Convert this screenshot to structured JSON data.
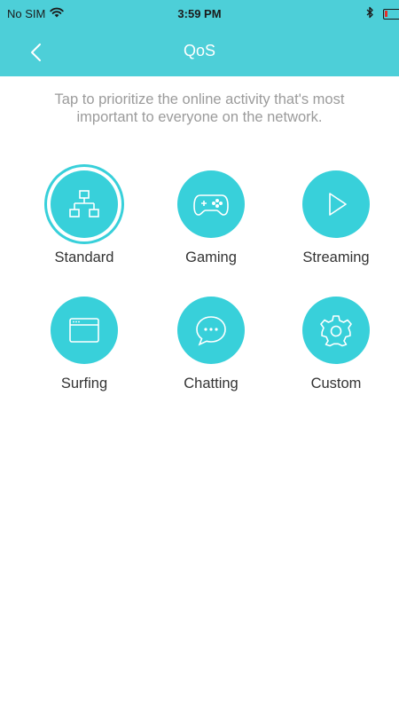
{
  "status_bar": {
    "carrier": "No SIM",
    "time": "3:59 PM",
    "wifi_icon": "wifi-icon",
    "bluetooth_icon": "bluetooth-icon",
    "battery_icon": "battery-low-icon"
  },
  "nav": {
    "title": "QoS",
    "back_icon": "chevron-left-icon"
  },
  "description": "Tap to prioritize the online activity that's most important to everyone on the network.",
  "options": [
    {
      "label": "Standard",
      "icon": "network-icon",
      "selected": true
    },
    {
      "label": "Gaming",
      "icon": "gamepad-icon",
      "selected": false
    },
    {
      "label": "Streaming",
      "icon": "play-icon",
      "selected": false
    },
    {
      "label": "Surfing",
      "icon": "browser-window-icon",
      "selected": false
    },
    {
      "label": "Chatting",
      "icon": "chat-bubble-icon",
      "selected": false
    },
    {
      "label": "Custom",
      "icon": "gear-icon",
      "selected": false
    }
  ],
  "colors": {
    "accent": "#38d0da",
    "header": "#4dcfd8",
    "text": "#333333",
    "muted": "#9b9b9b"
  }
}
